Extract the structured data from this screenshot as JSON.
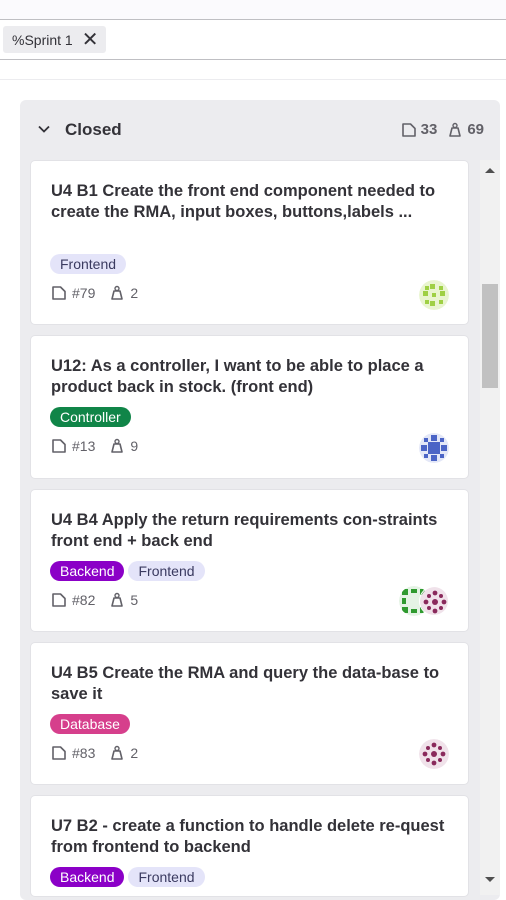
{
  "filter": {
    "token_label": "%Sprint 1"
  },
  "board": {
    "title": "Closed",
    "issue_count": "33",
    "weight_total": "69"
  },
  "cards": [
    {
      "title": "U4 B1 Create the front end component needed to create the RMA, input boxes, buttons,labels ...",
      "labels": [
        "Frontend"
      ],
      "number": "#79",
      "weight": "2"
    },
    {
      "title": "U12: As a controller, I want to be able to place a product back in stock. (front end)",
      "labels": [
        "Controller"
      ],
      "number": "#13",
      "weight": "9"
    },
    {
      "title": "U4 B4 Apply the return requirements con-straints front end + back end",
      "labels": [
        "Backend",
        "Frontend"
      ],
      "number": "#82",
      "weight": "5"
    },
    {
      "title": "U4 B5 Create the RMA and query the data-base to save it",
      "labels": [
        "Database"
      ],
      "number": "#83",
      "weight": "2"
    },
    {
      "title": "U7 B2 - create a function to handle delete re-quest from frontend to backend",
      "labels": [
        "Backend",
        "Frontend"
      ]
    }
  ],
  "colors": {
    "frontend": "#e4e4f9",
    "controller": "#108548",
    "backend": "#8b00c7",
    "database": "#d63f8c"
  }
}
